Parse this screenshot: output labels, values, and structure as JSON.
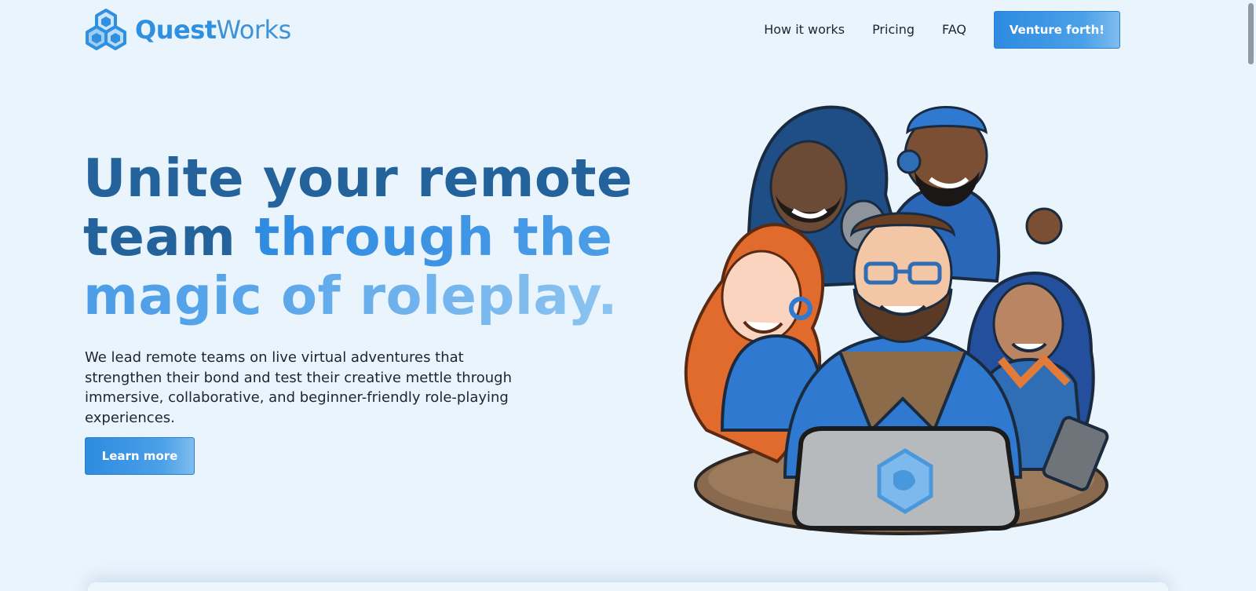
{
  "brand": {
    "name_part1": "Quest",
    "name_part2": "Works",
    "logo_icon": "hexagon-cubes-icon",
    "color_primary": "#2f8fe0",
    "color_dark": "#23629a"
  },
  "nav": {
    "links": [
      {
        "label": "How it works"
      },
      {
        "label": "Pricing"
      },
      {
        "label": "FAQ"
      }
    ],
    "cta_label": "Venture forth!"
  },
  "hero": {
    "headline_dark": "Unite your remote team ",
    "headline_accent": "through the magic of roleplay.",
    "lede": "We lead remote teams on live virtual adventures that strengthen their bond and test their creative mettle through immersive, collaborative, and beginner-friendly role-playing experiences.",
    "learn_more_label": "Learn more",
    "illustration_icon": "adventurer-party-illustration"
  },
  "colors": {
    "page_background": "#eaf4fd",
    "button_gradient_start": "#2e8be0",
    "button_gradient_end": "#7ebcee",
    "text": "#1d2530"
  }
}
